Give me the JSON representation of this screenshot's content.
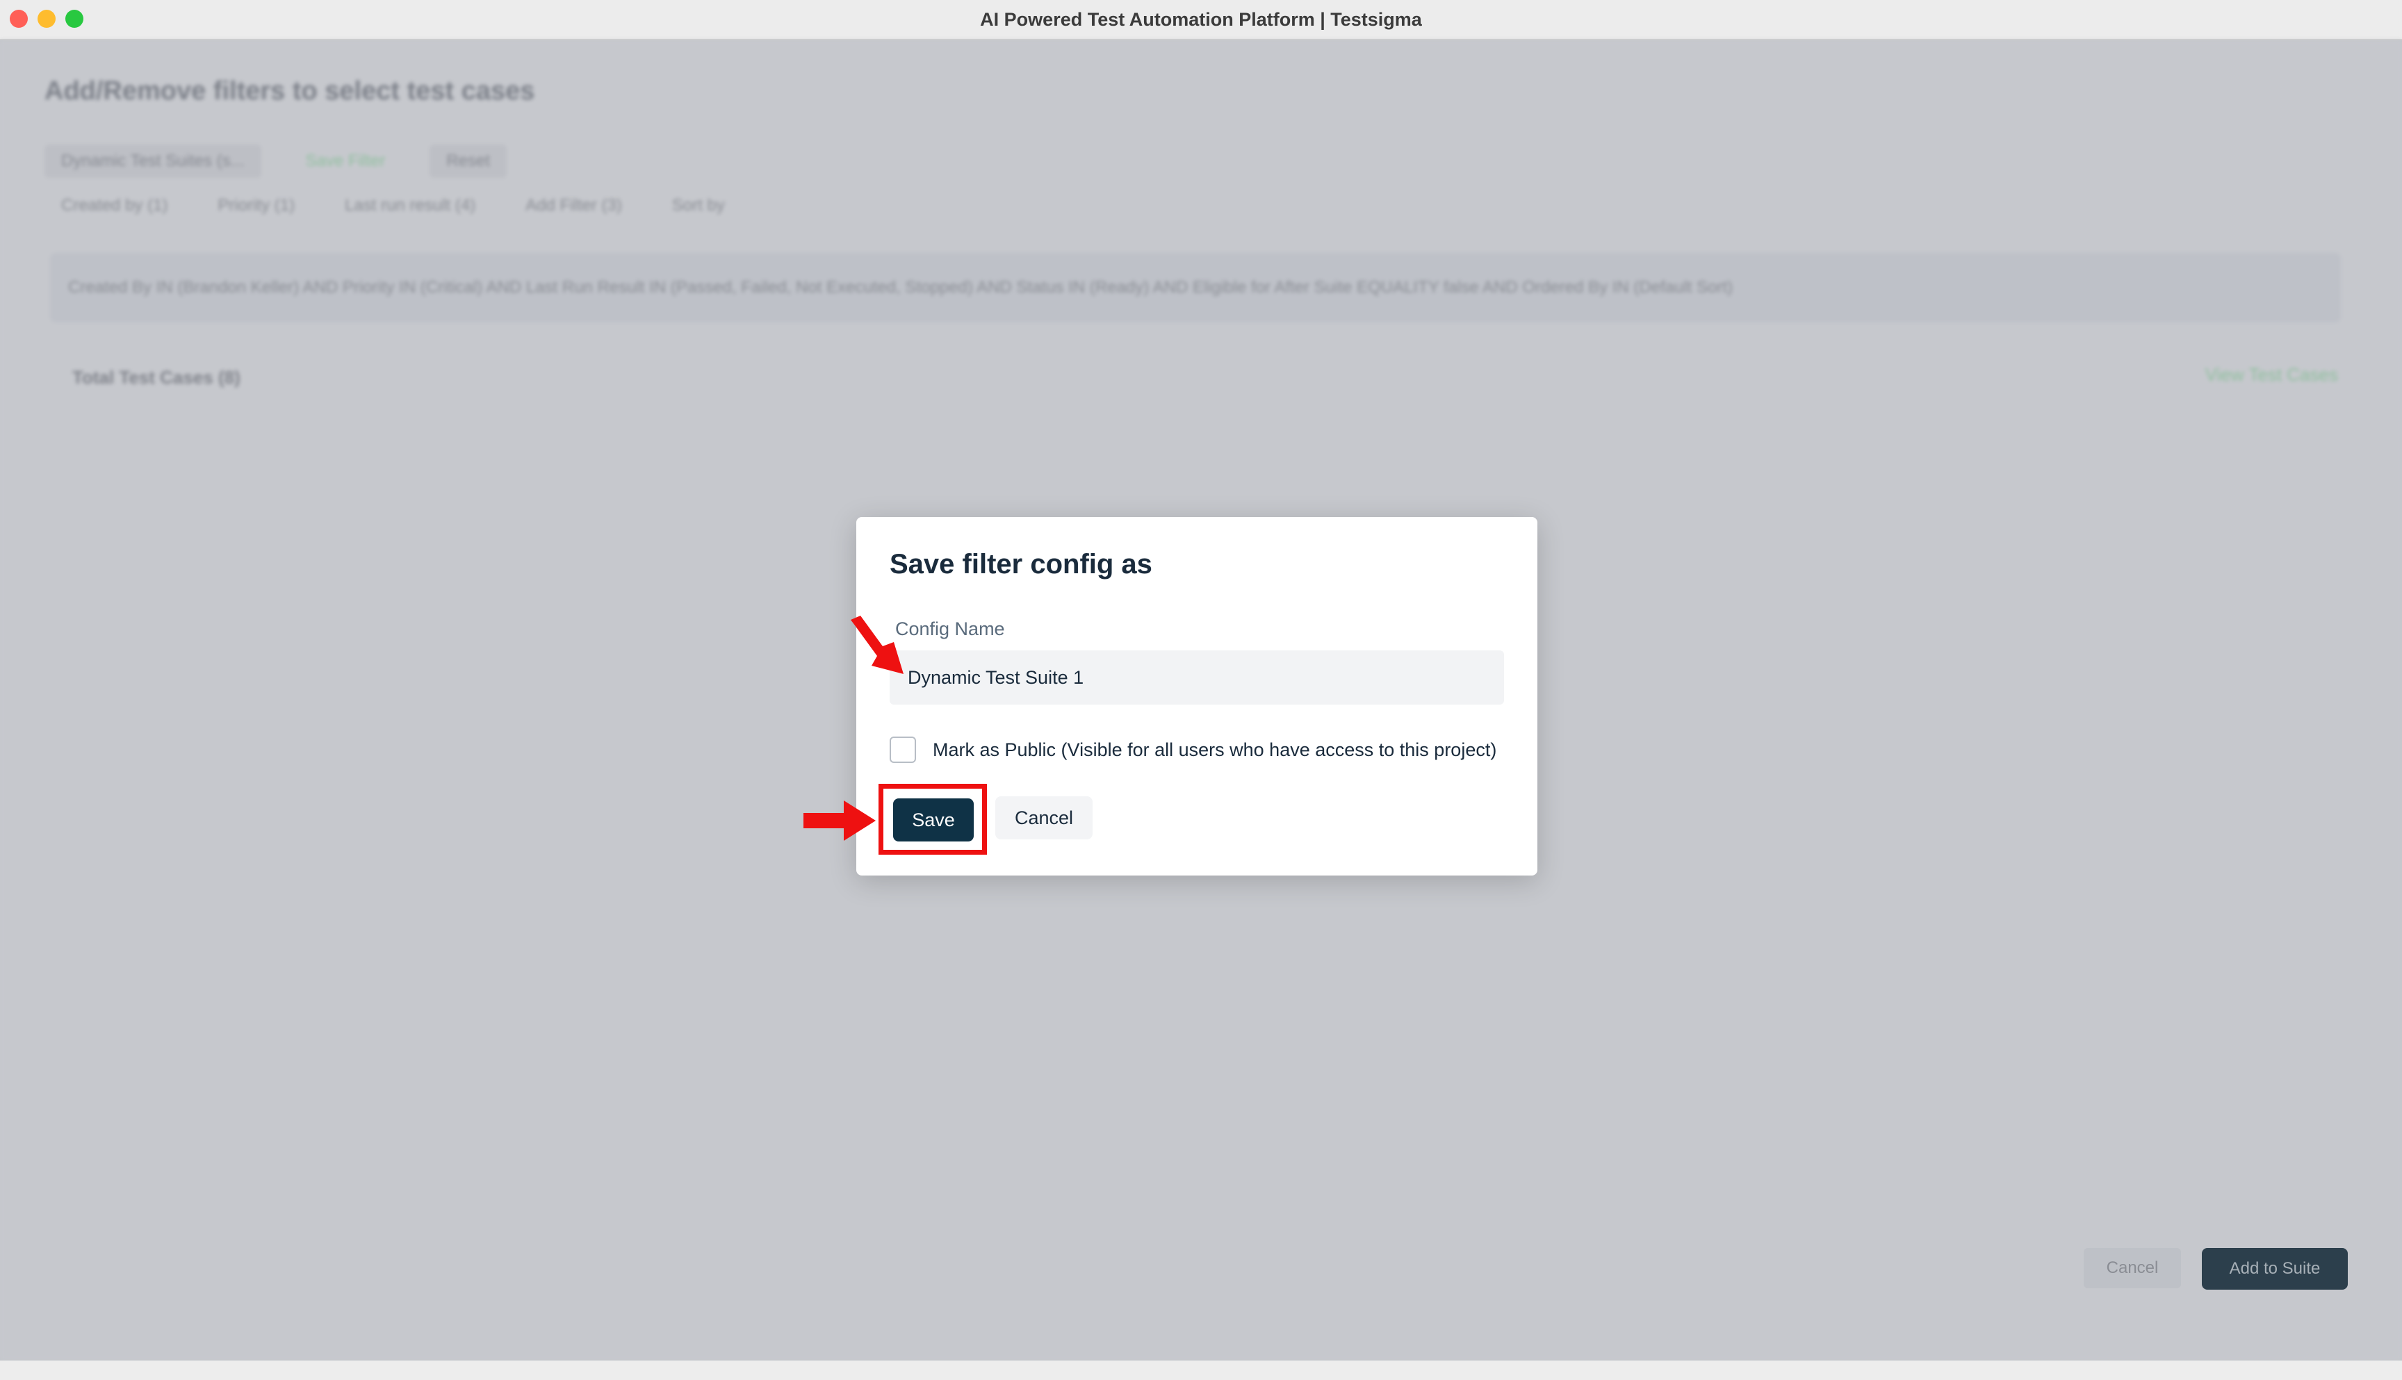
{
  "window": {
    "title": "AI Powered Test Automation Platform | Testsigma"
  },
  "background": {
    "heading": "Add/Remove filters to select test cases",
    "top_chips": [
      "Dynamic Test Suites (s...",
      "Save Filter",
      "Reset"
    ],
    "filters": [
      "Created by (1)",
      "Priority (1)",
      "Last run result (4)",
      "Add Filter (3)",
      "Sort by"
    ],
    "query": "Created By IN (Brandon Keller) AND Priority IN (Critical) AND Last Run Result IN (Passed, Failed, Not Executed, Stopped) AND Status IN (Ready) AND Eligible for After Suite EQUALITY false AND Ordered By IN (Default Sort)",
    "total": "Total Test Cases (8)",
    "view_link": "View Test Cases",
    "footer_cancel": "Cancel",
    "footer_add": "Add to Suite"
  },
  "modal": {
    "title": "Save filter config as",
    "config_label": "Config Name",
    "config_value": "Dynamic Test Suite 1",
    "public_label": "Mark as Public (Visible for all users who have access to this project)",
    "public_checked": false,
    "save_label": "Save",
    "cancel_label": "Cancel"
  },
  "annotations": {
    "highlight_color": "#ee1111"
  }
}
